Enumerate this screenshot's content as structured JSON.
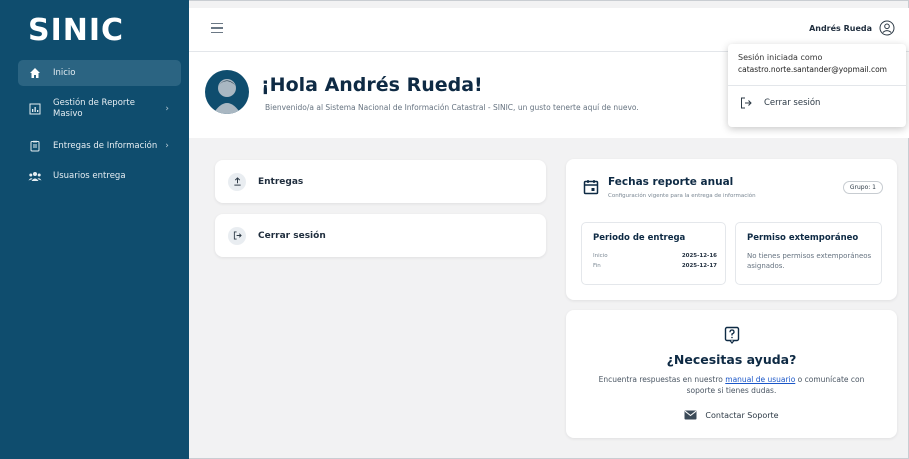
{
  "brand": {
    "logo": "SINIC"
  },
  "sidebar": {
    "items": [
      {
        "label": "Inicio",
        "icon": "home-icon",
        "active": true
      },
      {
        "label": "Gestión de Reporte Masivo",
        "icon": "chart-icon"
      },
      {
        "label": "Entregas de Información",
        "icon": "clipboard-icon"
      },
      {
        "label": "Usuarios entrega",
        "icon": "users-icon"
      }
    ]
  },
  "topbar": {
    "user_name": "Andrés Rueda"
  },
  "dropdown": {
    "line1": "Sesión iniciada como",
    "email": "catastro.norte.santander@yopmail.com",
    "logout": "Cerrar sesión"
  },
  "welcome": {
    "title": "¡Hola Andrés Rueda!",
    "subtitle": "Bienvenido/a al Sistema Nacional de Información Catastral - SINIC, un gusto tenerte aquí de nuevo."
  },
  "actions": [
    {
      "label": "Entregas",
      "icon": "upload-icon"
    },
    {
      "label": "Cerrar sesión",
      "icon": "logout-icon"
    }
  ],
  "fechas": {
    "title": "Fechas reporte anual",
    "subtitle": "Configuración vigente para la entrega de información",
    "badge": "Grupo: 1",
    "periodo": {
      "title": "Periodo de entrega",
      "inicio_label": "Inicio",
      "inicio_value": "2025-12-16",
      "fin_label": "Fin",
      "fin_value": "2025-12-17"
    },
    "permiso": {
      "title": "Permiso extemporáneo",
      "text": "No tienes permisos extemporáneos asignados."
    }
  },
  "ayuda": {
    "title": "¿Necesitas ayuda?",
    "text_before": "Encuentra respuestas en nuestro",
    "link": "manual de usuario",
    "text_after": "o comunícate con soporte si tienes dudas.",
    "contact": "Contactar Soporte"
  },
  "colors": {
    "sidebar": "#0f4d6e",
    "accent": "#0e2a44",
    "link": "#1a56c8"
  }
}
